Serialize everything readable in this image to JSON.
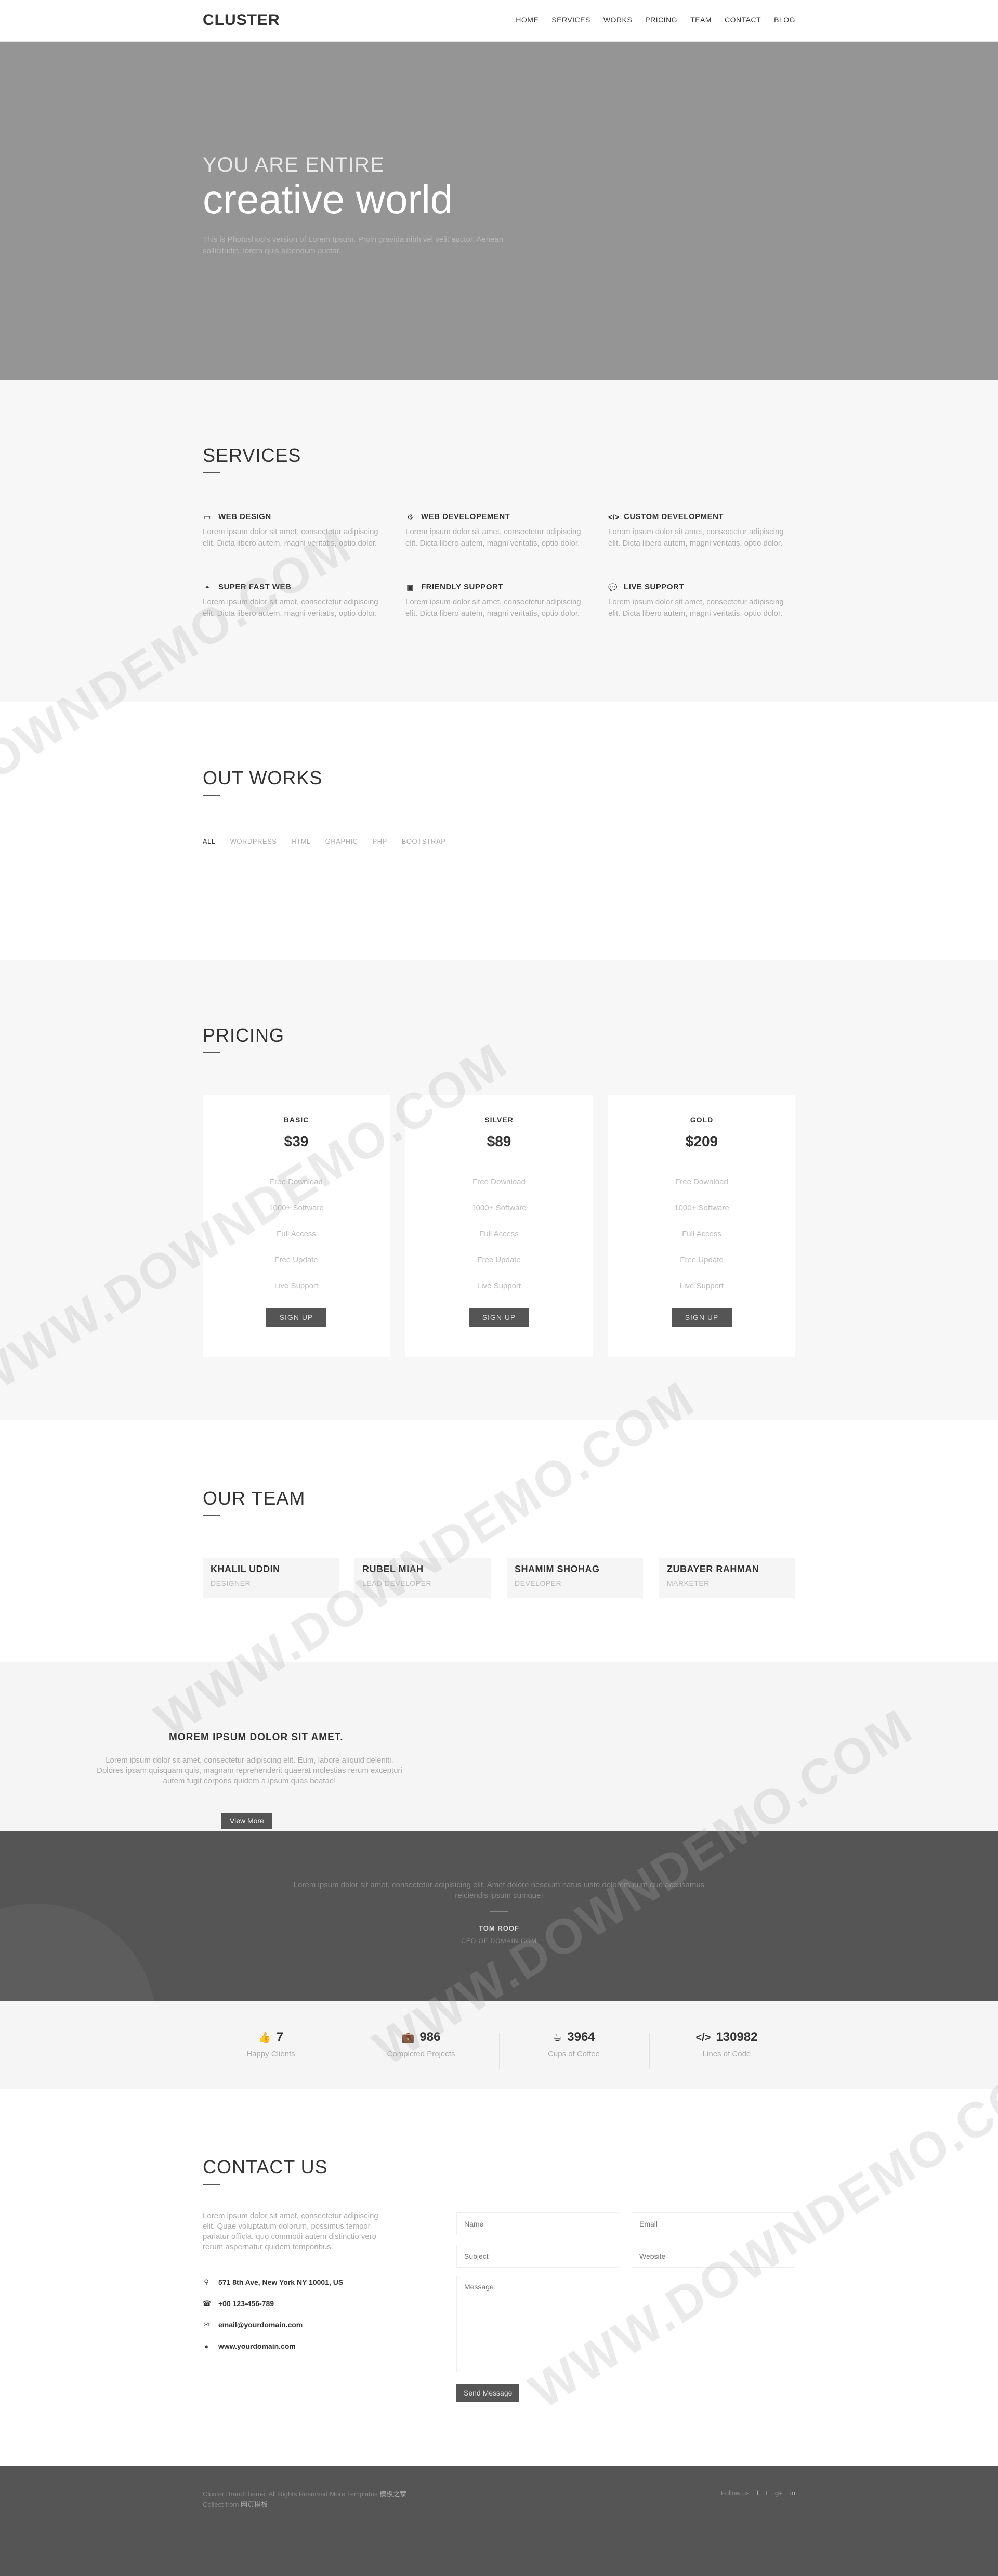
{
  "header": {
    "logo": "CLUSTER",
    "nav": [
      "HOME",
      "SERVICES",
      "WORKS",
      "PRICING",
      "TEAM",
      "CONTACT",
      "BLOG"
    ]
  },
  "hero": {
    "tagline": "YOU ARE ENTIRE",
    "headline": "creative world",
    "text": "This is Photoshop's version of Lorem Ipsum. Proin gravida nibh vel velit auctor. Aenean sollicitudin, lorem quis bibendum auctor."
  },
  "services": {
    "title": "SERVICES",
    "items": [
      {
        "icon": "monitor-icon",
        "title": "WEB DESIGN",
        "text": "Lorem ipsum dolor sit amet, consectetur adipiscing elit. Dicta libero autem, magni veritatis, optio dolor."
      },
      {
        "icon": "gears-icon",
        "title": "WEB DEVELOPEMENT",
        "text": "Lorem ipsum dolor sit amet, consectetur adipiscing elit. Dicta libero autem, magni veritatis, optio dolor."
      },
      {
        "icon": "code-icon",
        "title": "CUSTOM DEVELOPMENT",
        "text": "Lorem ipsum dolor sit amet, consectetur adipiscing elit. Dicta libero autem, magni veritatis, optio dolor."
      },
      {
        "icon": "dashboard-icon",
        "title": "SUPER FAST WEB",
        "text": "Lorem ipsum dolor sit amet, consectetur adipiscing elit. Dicta libero autem, magni veritatis, optio dolor."
      },
      {
        "icon": "square-icon",
        "title": "FRIENDLY SUPPORT",
        "text": "Lorem ipsum dolor sit amet, consectetur adipiscing elit. Dicta libero autem, magni veritatis, optio dolor."
      },
      {
        "icon": "chat-icon",
        "title": "LIVE SUPPORT",
        "text": "Lorem ipsum dolor sit amet, consectetur adipiscing elit. Dicta libero autem, magni veritatis, optio dolor."
      }
    ]
  },
  "works": {
    "title": "OUT WORKS",
    "filters": [
      "ALL",
      "WORDPRESS",
      "HTML",
      "GRAPHIC",
      "PHP",
      "BOOTSTRAP"
    ],
    "active_filter": "ALL"
  },
  "pricing": {
    "title": "PRICING",
    "plans": [
      {
        "name": "BASIC",
        "price": "$39",
        "features": [
          "Free Download",
          "1000+ Software",
          "Full Access",
          "Free Update",
          "Live Support"
        ],
        "button": "SIGN UP"
      },
      {
        "name": "SILVER",
        "price": "$89",
        "features": [
          "Free Download",
          "1000+ Software",
          "Full Access",
          "Free Update",
          "Live Support"
        ],
        "button": "SIGN UP"
      },
      {
        "name": "GOLD",
        "price": "$209",
        "features": [
          "Free Download",
          "1000+ Software",
          "Full Access",
          "Free Update",
          "Live Support"
        ],
        "button": "SIGN UP"
      }
    ]
  },
  "team": {
    "title": "OUR TEAM",
    "members": [
      {
        "name": "KHALIL UDDIN",
        "role": "DESIGNER"
      },
      {
        "name": "RUBEL MIAH",
        "role": "LEAD DEVELOPER"
      },
      {
        "name": "SHAMIM SHOHAG",
        "role": "DEVELOPER"
      },
      {
        "name": "ZUBAYER RAHMAN",
        "role": "MARKETER"
      }
    ]
  },
  "about": {
    "heading": "MOREM IPSUM DOLOR SIT AMET.",
    "text": "Lorem ipsum dolor sit amet, consectetur adipiscing elit. Eum, labore aliquid deleniti. Dolores ipsam quisquam quis, magnam reprehenderit quaerat molestias rerum excepturi autem fugit corporis quidem a ipsum quas beatae!",
    "button": "View More"
  },
  "testimonial": {
    "quote": "Lorem ipsum dolor sit amet, consectetur adipisicing elit. Amet dolore nescium natus iusto dolorem eum quo accusamus reiciendis ipsum cumque!",
    "name": "TOM ROOF",
    "role": "CEO OF DOMAIN.COM"
  },
  "stats": [
    {
      "icon": "thumbs-up-icon",
      "value": "7",
      "label": "Happy Clients"
    },
    {
      "icon": "briefcase-icon",
      "value": "986",
      "label": "Completed Projects"
    },
    {
      "icon": "coffee-icon",
      "value": "3964",
      "label": "Cups of Coffee"
    },
    {
      "icon": "code-icon",
      "value": "130982",
      "label": "Lines of Code"
    }
  ],
  "contact": {
    "title": "CONTACT US",
    "intro": "Lorem ipsum dolor sit amet, consectetur adipiscing elit. Quae voluptatum dolorum, possimus tempor pariatur officia, quo commodi autem distinctio vero rerum aspernatur quidem temporibus.",
    "address": "571 8th Ave, New York NY 10001, US",
    "phone": "+00 123-456-789",
    "email": "email@yourdomain.com",
    "website": "www.yourdomain.com",
    "form": {
      "name_placeholder": "Name",
      "email_placeholder": "Email",
      "subject_placeholder": "Subject",
      "website_placeholder": "Website",
      "message_placeholder": "Message",
      "send": "Send Message"
    }
  },
  "footer": {
    "copyright": "Cluster BrandTheme. All Rights Reserved.More Templates",
    "copyright_link": "模板之家",
    "collect": "Collect from",
    "collect_link": "网页模板",
    "follow": "Follow us",
    "social": [
      "f",
      "t",
      "g+",
      "in"
    ]
  },
  "watermark": "WWW.DOWNDEMO.COM"
}
